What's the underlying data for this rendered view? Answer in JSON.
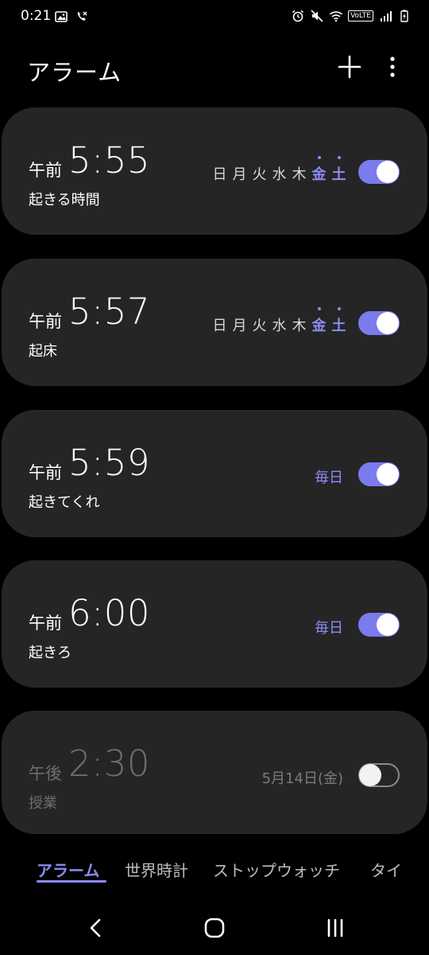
{
  "status_bar": {
    "time": "0:21",
    "volte": "VoLTE",
    "left_icons": [
      "image-icon",
      "call-forward-icon"
    ],
    "right_icons": [
      "alarm-clock-icon",
      "mute-icon",
      "wifi-icon",
      "signal-icon",
      "battery-icon"
    ]
  },
  "header": {
    "title": "アラーム",
    "add_icon": "plus-icon",
    "more_icon": "more-vertical-icon"
  },
  "colors": {
    "accent": "#8c8cf6",
    "toggle_on": "#7b7bee",
    "card": "#252525",
    "background": "#000000",
    "disabled_text": "#6e6e6e"
  },
  "alarms": [
    {
      "ampm": "午前",
      "time": "5:55",
      "label": "起きる時間",
      "enabled": true,
      "days": [
        "日",
        "月",
        "火",
        "水",
        "木",
        "金",
        "土"
      ],
      "active_days": [
        "金",
        "土"
      ]
    },
    {
      "ampm": "午前",
      "time": "5:57",
      "label": "起床",
      "enabled": true,
      "days": [
        "日",
        "月",
        "火",
        "水",
        "木",
        "金",
        "土"
      ],
      "active_days": [
        "金",
        "土"
      ]
    },
    {
      "ampm": "午前",
      "time": "5:59",
      "label": "起きてくれ",
      "enabled": true,
      "repeat": "毎日"
    },
    {
      "ampm": "午前",
      "time": "6:00",
      "label": "起きろ",
      "enabled": true,
      "repeat": "毎日"
    },
    {
      "ampm": "午後",
      "time": "2:30",
      "label": "授業",
      "enabled": false,
      "repeat": "5月14日(金)"
    }
  ],
  "tabs": [
    {
      "label": "アラーム",
      "active": true
    },
    {
      "label": "世界時計",
      "active": false
    },
    {
      "label": "ストップウォッチ",
      "active": false
    },
    {
      "label": "タイ",
      "active": false
    }
  ],
  "nav": {
    "back_icon": "back-icon",
    "home_icon": "home-icon",
    "recents_icon": "recents-icon"
  }
}
